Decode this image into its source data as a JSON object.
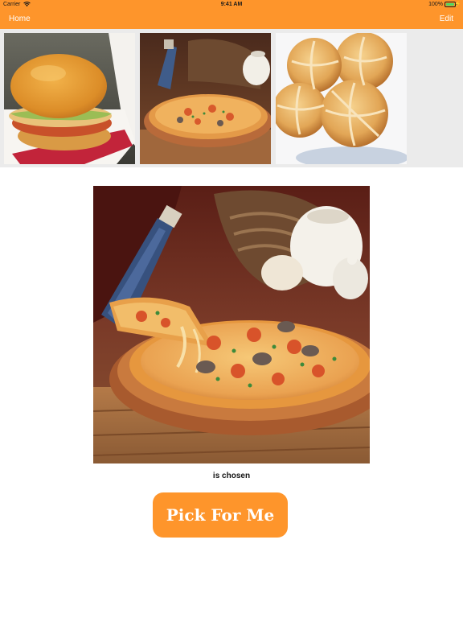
{
  "status_bar": {
    "carrier": "Carrier",
    "time": "9:41 AM",
    "battery": "100%"
  },
  "nav": {
    "left_label": "Home",
    "right_label": "Edit"
  },
  "colors": {
    "accent": "#fe952b",
    "strip_background": "#ebebeb"
  },
  "thumbnails": [
    {
      "name": "burger",
      "icon": "burger-photo"
    },
    {
      "name": "pizza",
      "icon": "pizza-photo"
    },
    {
      "name": "bread-rolls",
      "icon": "bread-photo"
    }
  ],
  "selection": {
    "image": "pizza-photo",
    "label": "is chosen"
  },
  "action": {
    "button_label": "Pick For Me"
  }
}
